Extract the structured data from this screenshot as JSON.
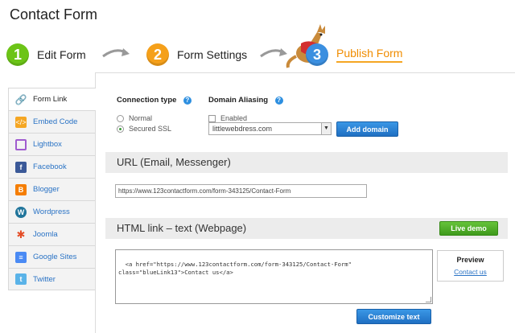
{
  "page": {
    "title": "Contact Form"
  },
  "steps": [
    {
      "num": "1",
      "label": "Edit Form"
    },
    {
      "num": "2",
      "label": "Form Settings"
    },
    {
      "num": "3",
      "label": "Publish Form"
    }
  ],
  "sidebar": {
    "items": [
      {
        "label": "Form Link",
        "icon": "link-icon"
      },
      {
        "label": "Embed Code",
        "icon": "embed-code-icon"
      },
      {
        "label": "Lightbox",
        "icon": "lightbox-icon"
      },
      {
        "label": "Facebook",
        "icon": "facebook-icon"
      },
      {
        "label": "Blogger",
        "icon": "blogger-icon"
      },
      {
        "label": "Wordpress",
        "icon": "wordpress-icon"
      },
      {
        "label": "Joomla",
        "icon": "joomla-icon"
      },
      {
        "label": "Google Sites",
        "icon": "google-sites-icon"
      },
      {
        "label": "Twitter",
        "icon": "twitter-icon"
      }
    ]
  },
  "connection": {
    "title": "Connection type",
    "options": [
      "Normal",
      "Secured SSL"
    ],
    "selected": "Secured SSL"
  },
  "alias": {
    "title": "Domain Aliasing",
    "enabled_label": "Enabled",
    "domain_value": "littlewebdress.com",
    "add_button": "Add domain"
  },
  "url_section": {
    "title": "URL (Email, Messenger)",
    "url": "https://www.123contactform.com/form-343125/Contact-Form"
  },
  "html_section": {
    "title": "HTML link – text (Webpage)",
    "live_demo": "Live demo",
    "code": "<a href=\"https://www.123contactform.com/form-343125/Contact-Form\"\nclass=\"blueLink13\">Contact us</a>",
    "preview_title": "Preview",
    "preview_link": "Contact us",
    "customize_button": "Customize text"
  },
  "colors": {
    "step1": "#6cc417",
    "step2": "#f5a01a",
    "step3": "#3b8fe0",
    "accent_blue": "#2a73c5",
    "live_demo_green": "#4fae24"
  }
}
